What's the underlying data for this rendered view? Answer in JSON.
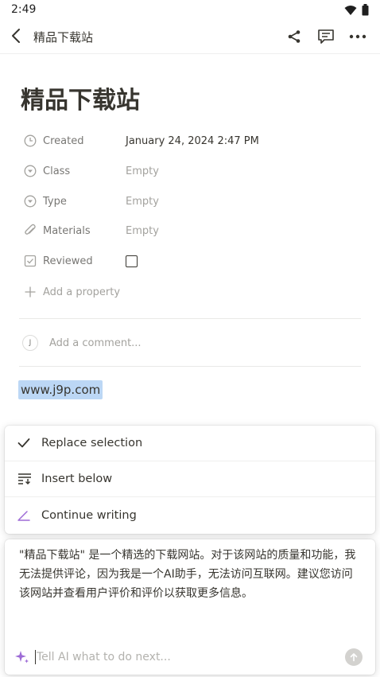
{
  "status_bar": {
    "time": "2:49"
  },
  "app_bar": {
    "title": "精品下载站"
  },
  "page": {
    "title": "精品下载站",
    "properties": [
      {
        "name": "Created",
        "value": "January 24, 2024 2:47 PM",
        "icon": "clock-icon"
      },
      {
        "name": "Class",
        "value": "Empty",
        "icon": "select-icon"
      },
      {
        "name": "Type",
        "value": "Empty",
        "icon": "select-icon"
      },
      {
        "name": "Materials",
        "value": "Empty",
        "icon": "paperclip-icon"
      },
      {
        "name": "Reviewed",
        "value": "",
        "icon": "checkbox-icon"
      }
    ],
    "add_property_label": "Add a property",
    "comment": {
      "avatar_initial": "J",
      "placeholder": "Add a comment..."
    },
    "selected_text": "www.j9p.com"
  },
  "ai_menu": {
    "items": [
      {
        "label": "Replace selection",
        "icon": "check-icon"
      },
      {
        "label": "Insert below",
        "icon": "insert-below-icon"
      },
      {
        "label": "Continue writing",
        "icon": "pen-icon"
      }
    ]
  },
  "ai_panel": {
    "response": "\"精品下载站\" 是一个精选的下载网站。对于该网站的质量和功能，我无法提供评论，因为我是一个AI助手，无法访问互联网。建议您访问该网站并查看用户评价和评价以获取更多信息。",
    "input_placeholder": "Tell AI what to do next..."
  },
  "colors": {
    "accent_purple": "#9d6bd6",
    "selection_blue": "#bcd7f5"
  }
}
